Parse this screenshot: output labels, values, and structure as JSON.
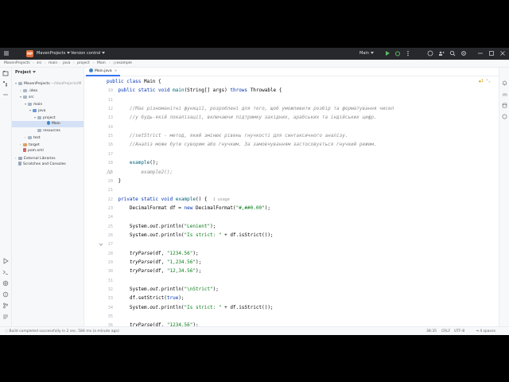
{
  "titlebar": {
    "project_badge": "MP",
    "project_name": "MavenProjects",
    "vcs": "Version control",
    "run_config": "Main"
  },
  "breadcrumbs": [
    "MavenProjects",
    "src",
    "main",
    "java",
    "project",
    "Main",
    "example"
  ],
  "project_panel": {
    "title": "Project",
    "tree": [
      {
        "label": "MavenProjects",
        "path": "~/IdeaProjects/M",
        "indent": 0,
        "arrow": "▾",
        "icon": "folder"
      },
      {
        "label": ".idea",
        "indent": 1,
        "arrow": "›",
        "icon": "folder"
      },
      {
        "label": "src",
        "indent": 1,
        "arrow": "▾",
        "icon": "folder"
      },
      {
        "label": "main",
        "indent": 2,
        "arrow": "▾",
        "icon": "folder"
      },
      {
        "label": "java",
        "indent": 3,
        "arrow": "▾",
        "icon": "folder-blue"
      },
      {
        "label": "project",
        "indent": 4,
        "arrow": "▾",
        "icon": "folder"
      },
      {
        "label": "Main",
        "indent": 5,
        "arrow": "",
        "icon": "class",
        "selected": true
      },
      {
        "label": "resources",
        "indent": 3,
        "arrow": "",
        "icon": "folder"
      },
      {
        "label": "test",
        "indent": 2,
        "arrow": "›",
        "icon": "folder"
      },
      {
        "label": "target",
        "indent": 1,
        "arrow": "›",
        "icon": "folder-orange"
      },
      {
        "label": "pom.xml",
        "indent": 1,
        "arrow": "",
        "icon": "maven"
      },
      {
        "label": "External Libraries",
        "indent": 0,
        "arrow": "›",
        "icon": "library"
      },
      {
        "label": "Scratches and Consoles",
        "indent": 0,
        "arrow": "",
        "icon": "scratch"
      }
    ]
  },
  "editor": {
    "tab_label": "Main.java",
    "warning_count": "1",
    "lines": [
      {
        "n": "",
        "html": "<span class=\"kw\">public class</span> Main {"
      },
      {
        "n": "10",
        "html": "    <span class=\"kw\">public static void</span> <span class=\"fn\">main</span>(String[] args) <span class=\"kw\">throws</span> Throwable {"
      },
      {
        "n": "11",
        "html": ""
      },
      {
        "n": "12",
        "html": "        <span class=\"cmt\">//Має різноманітні функції, розроблені для того, щоб уможливити розбір та форматування чисел</span>"
      },
      {
        "n": "13",
        "html": "        <span class=\"cmt\">//у будь-якій локалізації, включаючи підтримку західних, арабських та індійських цифр.</span>"
      },
      {
        "n": "14",
        "html": ""
      },
      {
        "n": "15",
        "html": "        <span class=\"cmt\">//setStrict - метод, який змінює рівень гнучкості для синтаксичного аналізу.</span>"
      },
      {
        "n": "16",
        "html": "        <span class=\"cmt\">//Аналіз може бути суворим або гнучким. За замовчуванням застосовується гнучкий режим.</span>"
      },
      {
        "n": "17",
        "html": ""
      },
      {
        "n": "18",
        "html": "        <span class=\"fn\">example</span>();"
      },
      {
        "n": "19",
        "html": "<span class=\"cmt\">//          example2();</span>"
      },
      {
        "n": "20",
        "html": "    }"
      },
      {
        "n": "21",
        "html": ""
      },
      {
        "n": "22",
        "html": "    <span class=\"kw\">private static void</span> <span class=\"fn\">example</span>() {  <span class=\"hint\">1 usage</span>"
      },
      {
        "n": "23",
        "html": "        DecimalFormat df = <span class=\"kw\">new</span> DecimalFormat(<span class=\"str\">\"#,##0.00\"</span>);"
      },
      {
        "n": "24",
        "html": ""
      },
      {
        "n": "25",
        "html": "        System.<i>out</i>.println(<span class=\"str\">\"Lenient\"</span>);"
      },
      {
        "n": "26",
        "html": "        System.<i>out</i>.println(<span class=\"str\">\"Is strict: \"</span> + df.isStrict());"
      },
      {
        "n": "27",
        "html": ""
      },
      {
        "n": "28",
        "html": "        <i>tryParse</i>(df, <span class=\"str\">\"1234.56\"</span>);"
      },
      {
        "n": "29",
        "html": "        <i>tryParse</i>(df, <span class=\"str\">\"1,234.56\"</span>);"
      },
      {
        "n": "30",
        "html": "        <i>tryParse</i>(df, <span class=\"str\">\"12,34.56\"</span>);"
      },
      {
        "n": "31",
        "html": ""
      },
      {
        "n": "32",
        "html": "        System.<i>out</i>.println(<span class=\"str\">\"\\nStrict\"</span>);"
      },
      {
        "n": "33",
        "html": "        df.setStrict(<span class=\"kw\">true</span>);"
      },
      {
        "n": "34",
        "html": "        System.<i>out</i>.println(<span class=\"str\">\"Is strict: \"</span> + df.isStrict());"
      },
      {
        "n": "35",
        "html": ""
      },
      {
        "n": "36",
        "html": "        <i>tryParse</i>(df, <span class=\"str\">\"1234.56\"</span>);"
      }
    ]
  },
  "status": {
    "message": "Build completed successfully in 2 sec, 584 ms (a minute ago)",
    "position": "38:35",
    "line_sep": "CRLF",
    "encoding": "UTF-8",
    "indent": "4 spaces"
  }
}
